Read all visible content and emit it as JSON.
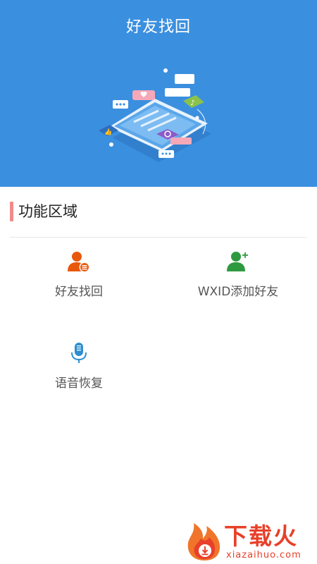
{
  "header": {
    "title": "好友找回",
    "background_color": "#3b8fdf",
    "illustration": "phone-chat-illustration"
  },
  "section": {
    "title": "功能区域",
    "accent_color": "#f08b8b"
  },
  "features": [
    {
      "label": "好友找回",
      "icon": "user-list-icon",
      "color": "#e8580c"
    },
    {
      "label": "WXID添加好友",
      "icon": "add-user-icon",
      "color": "#2e9a40"
    },
    {
      "label": "语音恢复",
      "icon": "microphone-icon",
      "color": "#2d8fd0"
    }
  ],
  "watermark": {
    "text": "下载火",
    "subtext": "xiazaihuo.com",
    "color": "#e8402a"
  }
}
